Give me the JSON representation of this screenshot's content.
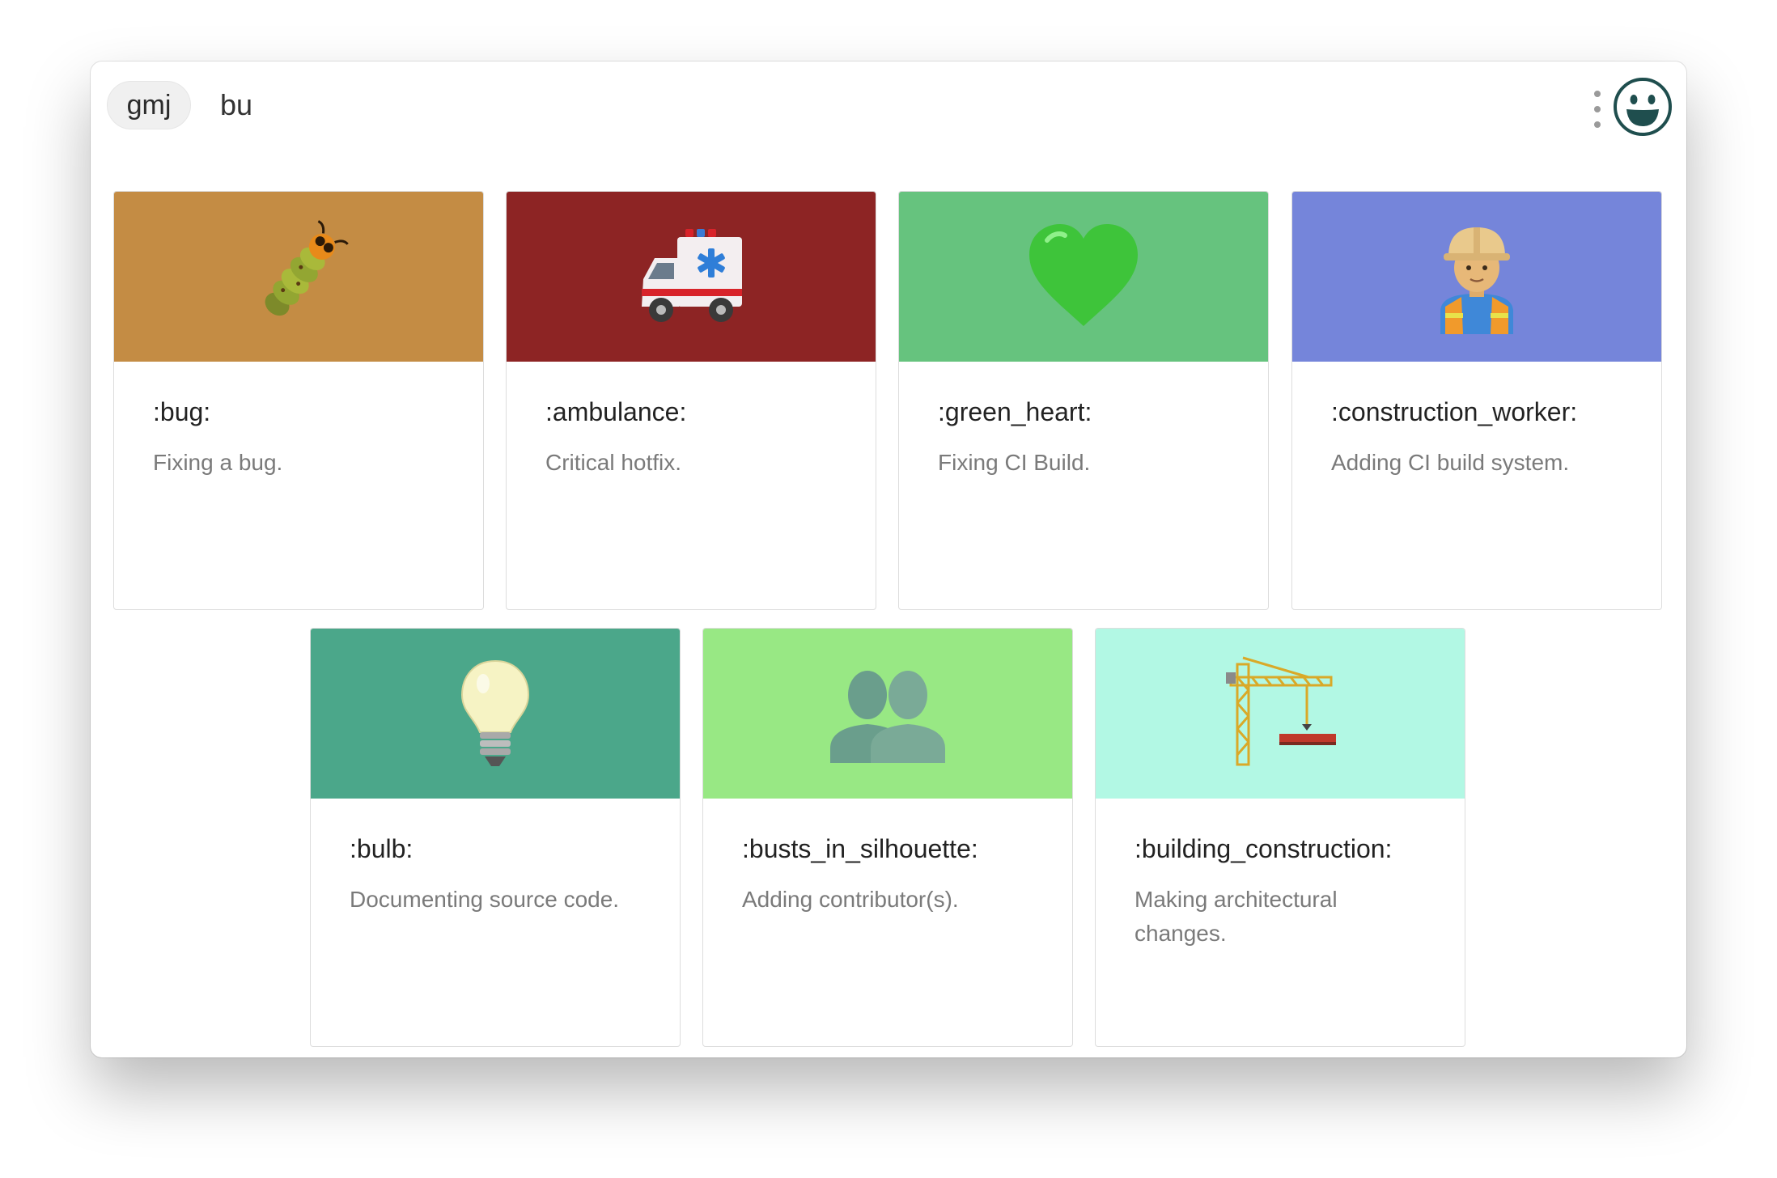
{
  "header": {
    "app_label": "gmj",
    "search_value": "bu"
  },
  "cards": [
    {
      "code": ":bug:",
      "description": "Fixing a bug.",
      "color": "#c48c44",
      "icon": "bug-icon"
    },
    {
      "code": ":ambulance:",
      "description": "Critical hotfix.",
      "color": "#8d2424",
      "icon": "ambulance-icon"
    },
    {
      "code": ":green_heart:",
      "description": "Fixing CI Build.",
      "color": "#66c37e",
      "icon": "green-heart-icon"
    },
    {
      "code": ":construction_worker:",
      "description": "Adding CI build system.",
      "color": "#7585da",
      "icon": "construction-worker-icon"
    },
    {
      "code": ":bulb:",
      "description": "Documenting source code.",
      "color": "#4ba78a",
      "icon": "bulb-icon"
    },
    {
      "code": ":busts_in_silhouette:",
      "description": "Adding contributor(s).",
      "color": "#98e884",
      "icon": "busts-in-silhouette-icon"
    },
    {
      "code": ":building_construction:",
      "description": "Making architectural changes.",
      "color": "#b2f8e4",
      "icon": "building-construction-icon"
    }
  ]
}
